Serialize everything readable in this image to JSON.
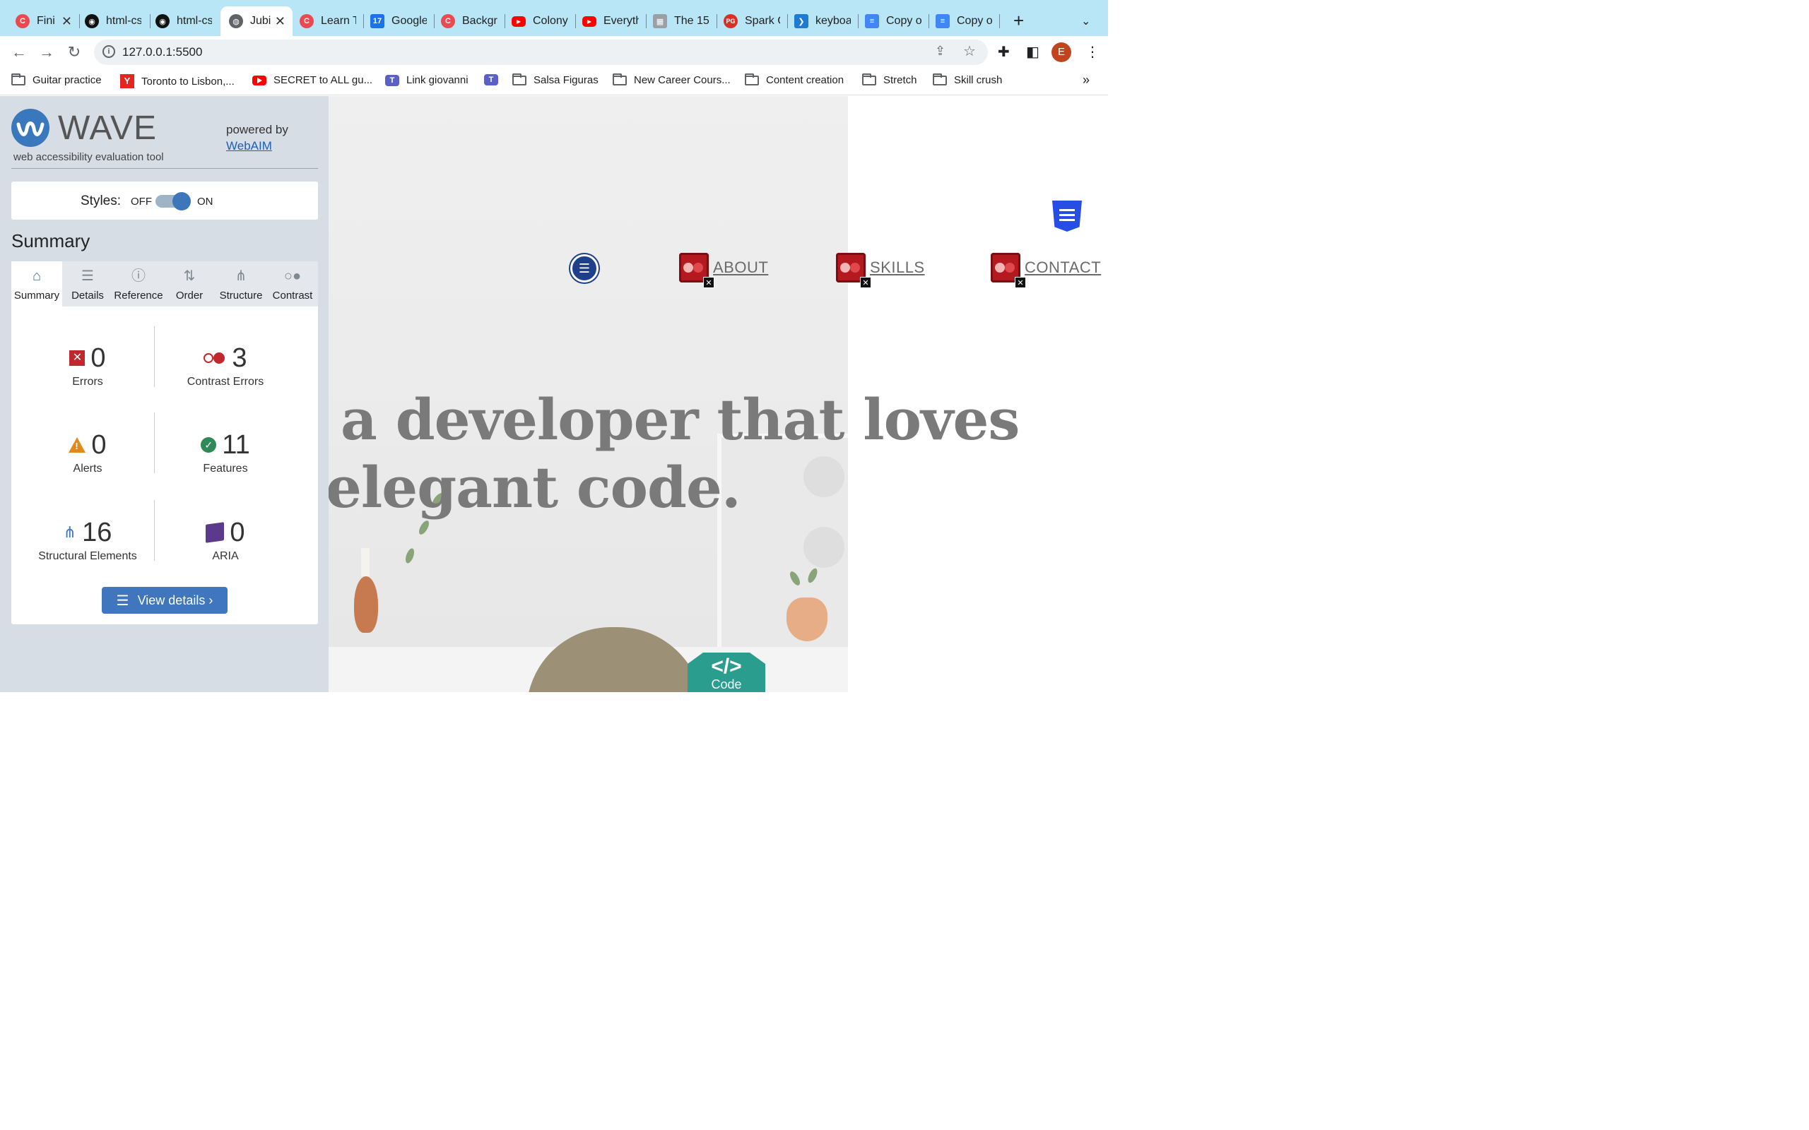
{
  "browser": {
    "tabs": [
      {
        "title": "Fini",
        "icon": "codecademy-icon",
        "color": "#e9494f",
        "active": false
      },
      {
        "title": "html-cs",
        "icon": "github-icon",
        "color": "#111111",
        "active": false
      },
      {
        "title": "html-cs",
        "icon": "github-icon",
        "color": "#111111",
        "active": false
      },
      {
        "title": "Jubi",
        "icon": "globe-icon",
        "color": "#5f6368",
        "active": true
      },
      {
        "title": "Learn T",
        "icon": "codecademy-icon",
        "color": "#e9494f",
        "active": false
      },
      {
        "title": "Google",
        "icon": "calendar-icon",
        "color": "#1a73e8",
        "active": false
      },
      {
        "title": "Backgro",
        "icon": "codecademy-icon",
        "color": "#e9494f",
        "active": false
      },
      {
        "title": "Colony",
        "icon": "youtube-icon",
        "color": "#ff0000",
        "active": false
      },
      {
        "title": "Everyth",
        "icon": "youtube-icon",
        "color": "#ff0000",
        "active": false
      },
      {
        "title": "The 15",
        "icon": "page-icon",
        "color": "#9aa0a6",
        "active": false
      },
      {
        "title": "Spark C",
        "icon": "pg-icon",
        "color": "#d93025",
        "active": false
      },
      {
        "title": "keyboa",
        "icon": "vscode-icon",
        "color": "#1f7ad1",
        "active": false
      },
      {
        "title": "Copy of",
        "icon": "docs-icon",
        "color": "#4285f4",
        "active": false
      },
      {
        "title": "Copy of",
        "icon": "docs-icon",
        "color": "#4285f4",
        "active": false
      }
    ],
    "active_close": "✕",
    "new_tab": "+",
    "tab_menu": "⌄",
    "url": "127.0.0.1:5500",
    "avatar_letter": "E",
    "bookmarks": [
      {
        "label": "Guitar practice",
        "icon": "folder-icon"
      },
      {
        "label": "Toronto to Lisbon,...",
        "icon": "yelp-icon"
      },
      {
        "label": "SECRET to ALL gu...",
        "icon": "youtube-icon"
      },
      {
        "label": "Link giovanni",
        "icon": "teams-icon"
      },
      {
        "label": "",
        "icon": "teams-icon"
      },
      {
        "label": "Salsa Figuras",
        "icon": "folder-icon"
      },
      {
        "label": "New Career Cours...",
        "icon": "folder-icon"
      },
      {
        "label": "Content creation",
        "icon": "folder-icon"
      },
      {
        "label": "Stretch",
        "icon": "folder-icon"
      },
      {
        "label": "Skill crush",
        "icon": "folder-icon"
      }
    ],
    "bookmarks_more": "»"
  },
  "wave": {
    "title": "WAVE",
    "subtitle": "web accessibility evaluation tool",
    "powered_by": "powered by",
    "webaim": "WebAIM",
    "styles_label": "Styles:",
    "off": "OFF",
    "on": "ON",
    "styles_on": true,
    "summary_heading": "Summary",
    "tabs": [
      {
        "label": "Summary",
        "icon": "home-icon",
        "glyph": "⌂"
      },
      {
        "label": "Details",
        "icon": "list-icon",
        "glyph": "☰"
      },
      {
        "label": "Reference",
        "icon": "info-icon",
        "glyph": "ⓘ"
      },
      {
        "label": "Order",
        "icon": "order-icon",
        "glyph": "⇅"
      },
      {
        "label": "Structure",
        "icon": "structure-icon",
        "glyph": "⋔"
      },
      {
        "label": "Contrast",
        "icon": "contrast-icon",
        "glyph": "○●"
      }
    ],
    "stats": {
      "errors": {
        "value": "0",
        "label": "Errors"
      },
      "contrast_errors": {
        "value": "3",
        "label": "Contrast Errors"
      },
      "alerts": {
        "value": "0",
        "label": "Alerts"
      },
      "features": {
        "value": "11",
        "label": "Features"
      },
      "structural": {
        "value": "16",
        "label": "Structural Elements"
      },
      "aria": {
        "value": "0",
        "label": "ARIA"
      }
    },
    "view_details": "View details ›"
  },
  "page": {
    "headline_line1": "a developer that loves",
    "headline_line2": "elegant code.",
    "nav": [
      "ABOUT",
      "SKILLS",
      "CONTACT"
    ],
    "code_glyph": "</>",
    "code_label": "Code"
  },
  "colors": {
    "tabstrip": "#b9e6f6",
    "wave_blue": "#3f76bd",
    "wave_panel": "#d7dde5",
    "contrast_red": "#c0282d",
    "feature_green": "#2e8b57",
    "code_teal": "#2a9d8f"
  }
}
